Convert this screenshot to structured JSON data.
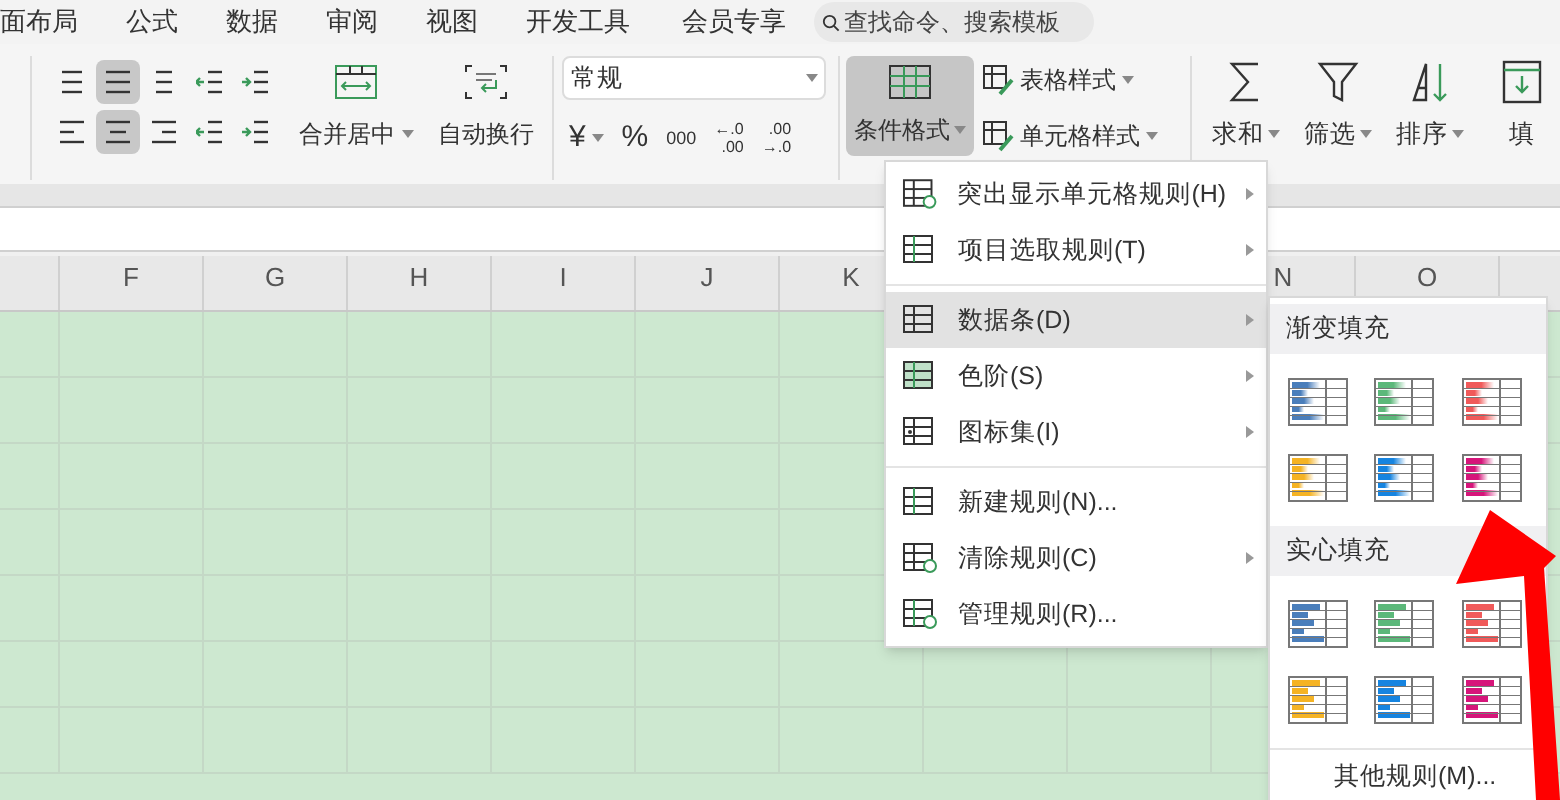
{
  "menu_tabs": [
    "面布局",
    "公式",
    "数据",
    "审阅",
    "视图",
    "开发工具",
    "会员专享"
  ],
  "search": {
    "placeholder": "查找命令、搜索模板"
  },
  "ribbon": {
    "alignment_buttons": [
      {
        "selected": false
      },
      {
        "selected": true
      },
      {
        "selected": false
      },
      {
        "selected": false
      },
      {
        "selected": false
      },
      {
        "selected": false
      },
      {
        "selected": true
      },
      {
        "selected": false
      },
      {
        "selected": false
      },
      {
        "selected": false
      }
    ],
    "merge_button": "合并居中",
    "wrap_button": "自动换行",
    "number_format": {
      "value": "常规"
    },
    "number_buttons": [
      {
        "kind": "text",
        "label": "¥",
        "dropdown": true
      },
      {
        "kind": "text",
        "label": "%",
        "dropdown": false
      },
      {
        "kind": "thousands",
        "label": "000"
      },
      {
        "kind": "stack",
        "top": "←.0",
        "bottom": ".00"
      },
      {
        "kind": "stack",
        "top": ".00",
        "bottom": "→.0"
      }
    ],
    "conditional_format": {
      "label": "条件格式",
      "selected": true
    },
    "style_buttons": [
      "表格样式",
      "单元格样式"
    ],
    "tool_buttons": [
      "求和",
      "筛选",
      "排序",
      "填"
    ]
  },
  "columns": [
    {
      "label": "F"
    },
    {
      "label": "G"
    },
    {
      "label": "H"
    },
    {
      "label": "I"
    },
    {
      "label": "J"
    },
    {
      "label": "K"
    },
    {},
    {},
    {
      "label": "N"
    },
    {
      "label": "O"
    }
  ],
  "conditional_menu": {
    "groups": [
      [
        {
          "label": "突出显示单元格规则(H)",
          "has_submenu": true,
          "selected": false
        },
        {
          "label": "项目选取规则(T)",
          "has_submenu": true,
          "selected": false
        }
      ],
      [
        {
          "label": "数据条(D)",
          "has_submenu": true,
          "selected": true
        },
        {
          "label": "色阶(S)",
          "has_submenu": true,
          "selected": false
        },
        {
          "label": "图标集(I)",
          "has_submenu": true,
          "selected": false
        }
      ],
      [
        {
          "label": "新建规则(N)...",
          "has_submenu": false,
          "selected": false
        },
        {
          "label": "清除规则(C)",
          "has_submenu": true,
          "selected": false
        },
        {
          "label": "管理规则(R)...",
          "has_submenu": false,
          "selected": false
        }
      ]
    ]
  },
  "data_bar_menu": {
    "sections": [
      {
        "title": "渐变填充",
        "kind": "gradient",
        "styles": [
          {
            "color": "#4a7ebb"
          },
          {
            "color": "#5cb87a"
          },
          {
            "color": "#f05a5a"
          },
          {
            "color": "#f5b324"
          },
          {
            "color": "#1684e0"
          },
          {
            "color": "#d6157a"
          }
        ]
      },
      {
        "title": "实心填充",
        "kind": "solid",
        "styles": [
          {
            "color": "#4a7ebb"
          },
          {
            "color": "#5cb87a"
          },
          {
            "color": "#f05a5a"
          },
          {
            "color": "#f5b324"
          },
          {
            "color": "#1684e0"
          },
          {
            "color": "#d6157a"
          }
        ]
      }
    ],
    "footer": "其他规则(M)..."
  }
}
